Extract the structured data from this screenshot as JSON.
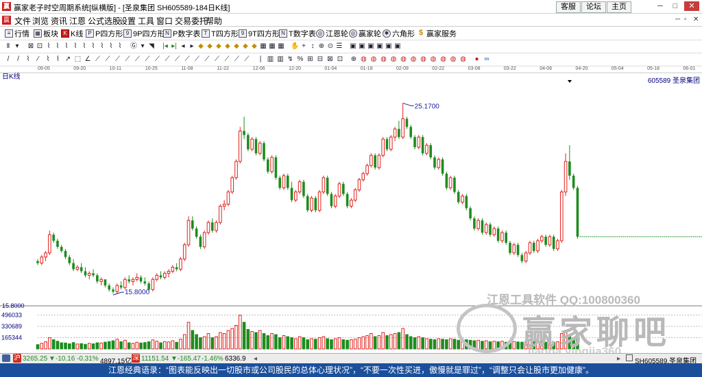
{
  "window": {
    "title": "赢家老子时空周期系统[纵横版] - [圣泉集团   SH605589-184日K线]",
    "links": [
      "客服",
      "论坛",
      "主页"
    ]
  },
  "menu": [
    "文件",
    "浏览",
    "资讯",
    "江恩",
    "公式选股",
    "设置",
    "工具",
    "窗口",
    "交易委托",
    "帮助"
  ],
  "toolbar": [
    {
      "icon": "list-icon",
      "label": "行情"
    },
    {
      "icon": "blocks-icon",
      "label": "板块"
    },
    {
      "icon": "kline-icon",
      "label": "K线"
    },
    {
      "icon": "p-square-icon",
      "label": "P四方形"
    },
    {
      "icon": "9p-square-icon",
      "label": "9P四方形"
    },
    {
      "icon": "pn-square-icon",
      "label": "P数字表"
    },
    {
      "icon": "t-square-icon",
      "label": "T四方形"
    },
    {
      "icon": "9t-square-icon",
      "label": "9T四方形"
    },
    {
      "icon": "tn-square-icon",
      "label": "T数字表"
    },
    {
      "icon": "wheel-icon",
      "label": "江恩轮"
    },
    {
      "icon": "wheel2-icon",
      "label": "赢家轮"
    },
    {
      "icon": "hexagon-icon",
      "label": "六角形"
    },
    {
      "icon": "dollar-icon",
      "label": "赢家服务"
    }
  ],
  "date_axis": [
    "09-05",
    "09-20",
    "10-11",
    "10-25",
    "11-08",
    "11-22",
    "12-06",
    "12-20",
    "01-04",
    "01-18",
    "02-09",
    "02-22",
    "03-08",
    "03-22",
    "04-06",
    "04-20",
    "05-04",
    "05-18",
    "06-01"
  ],
  "chart_label": "日K线",
  "stock_label": "605589 圣泉集团",
  "chart_data": {
    "type": "candlestick",
    "high_marker": "25.1700",
    "low_marker": "15.8000",
    "price_axis_label": "15.8000",
    "volume_ticks": [
      "496033",
      "330689",
      "165344"
    ],
    "volume_ticks_values": [
      496033,
      330689,
      165344
    ],
    "price_range": [
      15.3,
      26.0
    ],
    "candles": [
      [
        17.4,
        17.5,
        17.2,
        17.3
      ],
      [
        17.3,
        17.7,
        17.2,
        17.6
      ],
      [
        17.6,
        17.9,
        17.4,
        17.8
      ],
      [
        17.8,
        18.9,
        17.7,
        18.7
      ],
      [
        18.7,
        18.8,
        18.3,
        18.4
      ],
      [
        18.4,
        18.5,
        18.0,
        18.1
      ],
      [
        18.1,
        18.2,
        17.8,
        17.9
      ],
      [
        17.9,
        18.0,
        17.5,
        17.6
      ],
      [
        17.6,
        17.7,
        17.2,
        17.3
      ],
      [
        17.3,
        17.5,
        16.9,
        17.0
      ],
      [
        17.0,
        17.2,
        16.9,
        17.1
      ],
      [
        17.1,
        17.3,
        16.8,
        16.9
      ],
      [
        16.9,
        17.1,
        16.6,
        16.7
      ],
      [
        16.7,
        16.9,
        16.5,
        16.8
      ],
      [
        16.8,
        17.0,
        16.6,
        16.7
      ],
      [
        16.7,
        16.8,
        16.3,
        16.4
      ],
      [
        16.4,
        16.6,
        16.2,
        16.5
      ],
      [
        16.5,
        16.5,
        16.1,
        16.2
      ],
      [
        16.2,
        16.3,
        15.9,
        16.0
      ],
      [
        16.0,
        16.1,
        15.8,
        15.9
      ],
      [
        15.9,
        16.3,
        15.8,
        16.2
      ],
      [
        16.2,
        16.4,
        16.0,
        16.1
      ],
      [
        16.1,
        16.6,
        16.0,
        16.5
      ],
      [
        16.5,
        16.7,
        16.3,
        16.4
      ],
      [
        16.4,
        16.6,
        16.2,
        16.5
      ],
      [
        16.5,
        16.8,
        16.4,
        16.6
      ],
      [
        16.6,
        16.7,
        16.3,
        16.4
      ],
      [
        16.4,
        16.6,
        16.2,
        16.3
      ],
      [
        16.3,
        16.4,
        15.9,
        16.0
      ],
      [
        16.0,
        16.6,
        15.9,
        16.5
      ],
      [
        16.5,
        16.8,
        16.4,
        16.7
      ],
      [
        16.7,
        16.9,
        16.5,
        16.6
      ],
      [
        16.6,
        16.9,
        16.5,
        16.8
      ],
      [
        16.8,
        17.0,
        16.6,
        16.9
      ],
      [
        16.9,
        17.2,
        16.8,
        17.1
      ],
      [
        17.1,
        17.3,
        16.9,
        17.0
      ],
      [
        17.0,
        17.6,
        16.9,
        17.5
      ],
      [
        17.5,
        18.3,
        17.4,
        18.2
      ],
      [
        18.2,
        19.6,
        18.1,
        19.4
      ],
      [
        19.4,
        19.6,
        18.9,
        19.0
      ],
      [
        19.0,
        19.1,
        18.5,
        18.6
      ],
      [
        18.6,
        18.7,
        18.0,
        18.1
      ],
      [
        18.1,
        18.9,
        18.0,
        18.8
      ],
      [
        18.8,
        19.4,
        18.7,
        19.3
      ],
      [
        19.3,
        19.5,
        18.8,
        18.9
      ],
      [
        18.9,
        19.4,
        18.8,
        19.3
      ],
      [
        19.3,
        20.2,
        19.2,
        20.1
      ],
      [
        20.1,
        20.4,
        19.9,
        20.2
      ],
      [
        20.2,
        20.9,
        20.1,
        20.8
      ],
      [
        20.8,
        21.6,
        20.7,
        21.5
      ],
      [
        21.5,
        22.4,
        21.4,
        22.3
      ],
      [
        22.3,
        24.0,
        22.2,
        23.8
      ],
      [
        23.8,
        24.5,
        23.4,
        23.6
      ],
      [
        23.6,
        23.7,
        22.8,
        22.9
      ],
      [
        22.9,
        23.5,
        22.8,
        23.4
      ],
      [
        23.4,
        23.5,
        22.6,
        22.7
      ],
      [
        22.7,
        23.3,
        22.6,
        23.2
      ],
      [
        23.2,
        23.3,
        22.3,
        22.4
      ],
      [
        22.4,
        22.5,
        21.7,
        21.8
      ],
      [
        21.8,
        22.6,
        21.7,
        22.5
      ],
      [
        22.5,
        22.6,
        21.4,
        21.5
      ],
      [
        21.5,
        21.6,
        20.9,
        21.0
      ],
      [
        21.0,
        21.7,
        20.9,
        21.6
      ],
      [
        21.6,
        21.7,
        20.9,
        21.0
      ],
      [
        21.0,
        21.3,
        20.3,
        20.4
      ],
      [
        20.4,
        20.9,
        20.3,
        20.8
      ],
      [
        20.8,
        21.4,
        20.7,
        21.3
      ],
      [
        21.3,
        21.4,
        20.5,
        20.6
      ],
      [
        20.6,
        20.7,
        19.8,
        19.9
      ],
      [
        19.9,
        20.6,
        19.8,
        20.5
      ],
      [
        20.5,
        20.6,
        19.8,
        19.9
      ],
      [
        19.9,
        20.9,
        19.8,
        20.8
      ],
      [
        20.8,
        21.6,
        20.7,
        21.5
      ],
      [
        21.5,
        21.6,
        20.6,
        20.7
      ],
      [
        20.7,
        20.8,
        20.0,
        20.1
      ],
      [
        20.1,
        20.7,
        20.0,
        20.6
      ],
      [
        20.6,
        21.3,
        20.5,
        21.2
      ],
      [
        21.2,
        21.3,
        20.6,
        20.7
      ],
      [
        20.7,
        20.8,
        20.0,
        20.1
      ],
      [
        20.1,
        20.5,
        20.0,
        20.4
      ],
      [
        20.4,
        21.0,
        20.3,
        20.9
      ],
      [
        20.9,
        21.5,
        20.8,
        21.4
      ],
      [
        21.4,
        21.8,
        21.3,
        21.7
      ],
      [
        21.7,
        22.2,
        21.6,
        22.1
      ],
      [
        22.1,
        22.7,
        22.0,
        22.6
      ],
      [
        22.6,
        22.7,
        21.9,
        22.0
      ],
      [
        22.0,
        22.7,
        21.9,
        22.6
      ],
      [
        22.6,
        23.5,
        22.5,
        23.4
      ],
      [
        23.4,
        23.5,
        22.8,
        22.9
      ],
      [
        22.9,
        23.6,
        22.8,
        23.5
      ],
      [
        23.5,
        24.0,
        23.3,
        23.9
      ],
      [
        23.9,
        24.3,
        23.4,
        23.5
      ],
      [
        23.5,
        25.17,
        23.4,
        24.4
      ],
      [
        24.4,
        24.5,
        23.9,
        24.0
      ],
      [
        24.0,
        24.1,
        23.4,
        23.5
      ],
      [
        23.5,
        23.6,
        22.9,
        23.0
      ],
      [
        23.0,
        23.6,
        22.9,
        23.5
      ],
      [
        23.5,
        23.6,
        22.6,
        22.7
      ],
      [
        22.7,
        23.2,
        22.6,
        23.1
      ],
      [
        23.1,
        23.2,
        22.4,
        22.5
      ],
      [
        22.5,
        22.6,
        21.9,
        22.0
      ],
      [
        22.0,
        22.5,
        21.9,
        22.4
      ],
      [
        22.4,
        22.5,
        21.6,
        21.7
      ],
      [
        21.7,
        21.8,
        20.9,
        21.0
      ],
      [
        21.0,
        21.6,
        20.9,
        21.5
      ],
      [
        21.5,
        21.6,
        20.7,
        20.8
      ],
      [
        20.8,
        20.9,
        20.2,
        20.3
      ],
      [
        20.3,
        20.7,
        20.2,
        20.6
      ],
      [
        20.6,
        20.7,
        19.9,
        20.0
      ],
      [
        20.0,
        20.1,
        19.4,
        19.5
      ],
      [
        19.5,
        19.6,
        18.9,
        19.0
      ],
      [
        19.0,
        19.5,
        18.9,
        19.4
      ],
      [
        19.4,
        19.5,
        18.7,
        18.8
      ],
      [
        18.8,
        19.3,
        18.7,
        19.2
      ],
      [
        19.2,
        19.3,
        18.6,
        18.7
      ],
      [
        18.7,
        19.1,
        18.6,
        19.0
      ],
      [
        19.0,
        19.1,
        18.3,
        18.4
      ],
      [
        18.4,
        18.9,
        18.3,
        18.8
      ],
      [
        18.8,
        18.9,
        18.2,
        18.3
      ],
      [
        18.3,
        18.4,
        17.7,
        17.8
      ],
      [
        17.8,
        18.3,
        17.7,
        18.2
      ],
      [
        18.2,
        18.3,
        17.6,
        17.7
      ],
      [
        17.7,
        17.8,
        17.3,
        17.4
      ],
      [
        17.4,
        17.9,
        17.3,
        17.8
      ],
      [
        17.8,
        18.4,
        17.7,
        18.3
      ],
      [
        18.3,
        18.4,
        17.8,
        17.9
      ],
      [
        17.9,
        18.5,
        17.8,
        18.4
      ],
      [
        18.4,
        18.7,
        18.3,
        18.6
      ],
      [
        18.6,
        18.7,
        18.1,
        18.2
      ],
      [
        18.2,
        18.7,
        18.1,
        18.6
      ],
      [
        18.6,
        18.7,
        17.9,
        18.0
      ],
      [
        18.0,
        18.5,
        17.9,
        18.4
      ],
      [
        18.4,
        20.9,
        18.3,
        20.8
      ],
      [
        20.8,
        22.7,
        20.6,
        22.3
      ],
      [
        22.3,
        23.1,
        21.4,
        21.6
      ],
      [
        21.6,
        21.7,
        20.9,
        21.0
      ],
      [
        21.0,
        21.1,
        18.5,
        18.6
      ]
    ],
    "volumes": [
      42,
      55,
      70,
      110,
      90,
      75,
      60,
      58,
      50,
      62,
      48,
      52,
      45,
      55,
      50,
      60,
      58,
      66,
      72,
      80,
      95,
      70,
      85,
      60,
      55,
      65,
      58,
      62,
      70,
      88,
      75,
      60,
      70,
      68,
      80,
      65,
      95,
      140,
      260,
      180,
      140,
      110,
      120,
      150,
      110,
      120,
      160,
      150,
      180,
      200,
      230,
      330,
      260,
      190,
      170,
      160,
      180,
      150,
      130,
      150,
      140,
      110,
      130,
      120,
      110,
      100,
      120,
      110,
      90,
      100,
      95,
      110,
      120,
      100,
      90,
      100,
      110,
      90,
      85,
      90,
      95,
      110,
      120,
      130,
      150,
      120,
      130,
      160,
      130,
      140,
      150,
      160,
      200,
      140,
      120,
      110,
      120,
      110,
      100,
      95,
      90,
      100,
      95,
      90,
      100,
      95,
      85,
      80,
      90,
      85,
      80,
      85,
      75,
      80,
      70,
      75,
      70,
      75,
      65,
      70,
      72,
      68,
      66,
      70,
      80,
      70,
      75,
      72,
      66,
      70,
      65,
      70,
      150,
      160,
      130,
      110,
      150
    ],
    "price_line_value": 18.6
  },
  "status": {
    "sh_index": "3265.25",
    "sh_change": "▼-10.16",
    "sh_pct": "-0.31%",
    "sh_amount": "4897.15亿",
    "sz_index": "11151.54",
    "sz_change": "▼-165.47",
    "sz_pct": "-1.46%",
    "sz_amount": "6336.9",
    "stock_tab": "SH605589,圣泉集团"
  },
  "quote": "江恩经典语录：“图表能反映出一切股市或公司股民的总体心理状况”，“不要一次性买进，傲慢就是罪过”，“调整只会让股市更加健康”。",
  "watermark": {
    "software": "江恩工具软件  QQ:100800360",
    "brand": "赢家聊吧",
    "site": "jiaoba.yingjia360"
  },
  "colors": {
    "up": "#e0201c",
    "down": "#1e8c1e",
    "accent": "#1b4f9b",
    "axis": "#000080"
  }
}
